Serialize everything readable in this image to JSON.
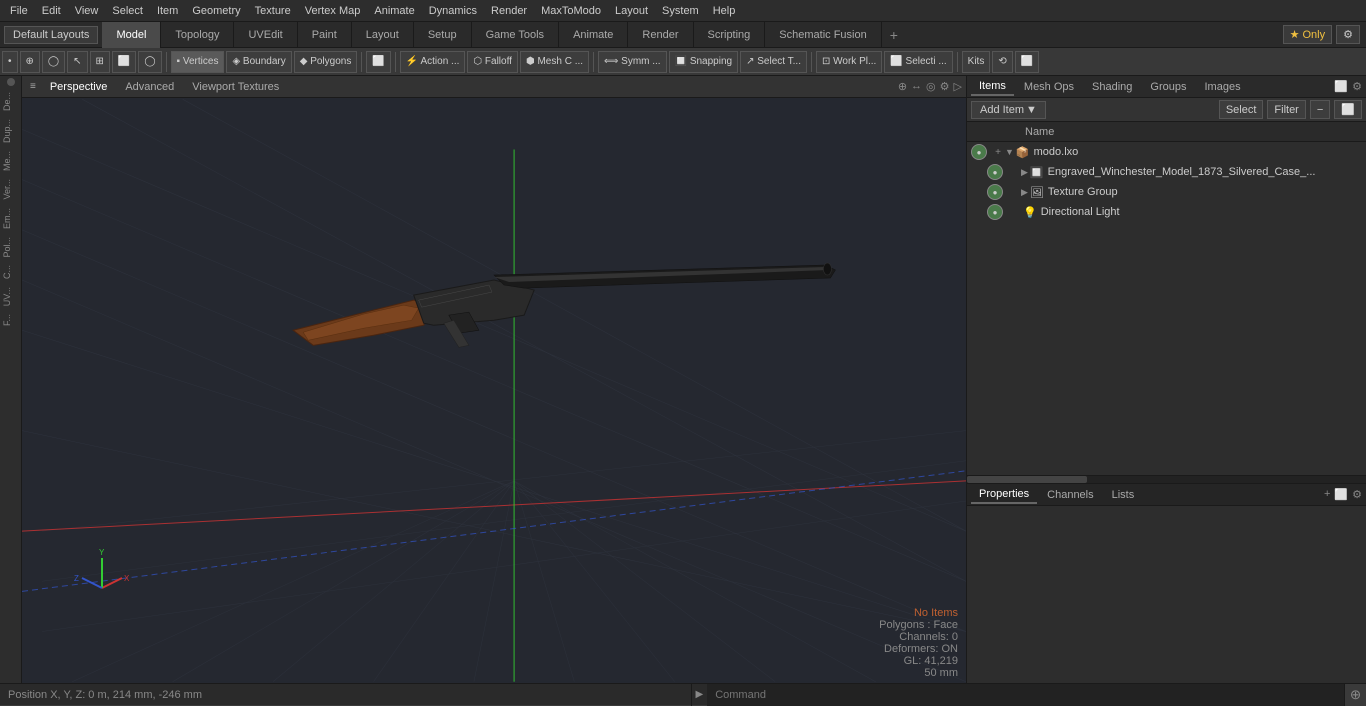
{
  "menubar": {
    "items": [
      "File",
      "Edit",
      "View",
      "Select",
      "Item",
      "Geometry",
      "Texture",
      "Vertex Map",
      "Animate",
      "Dynamics",
      "Render",
      "MaxToModo",
      "Layout",
      "System",
      "Help"
    ]
  },
  "layoutbar": {
    "layout_label": "Default Layouts",
    "tabs": [
      "Model",
      "Topology",
      "UVEdit",
      "Paint",
      "Layout",
      "Setup",
      "Game Tools",
      "Animate",
      "Render",
      "Scripting",
      "Schematic Fusion"
    ],
    "active_tab": "Model",
    "add_btn": "+",
    "star_label": "★ Only",
    "settings_label": "⚙"
  },
  "toolsbar": {
    "left_tools": [
      "•",
      "⊕",
      "◯",
      "↖",
      "⊞",
      "⬜",
      "◯"
    ],
    "selection_modes": [
      "Vertices",
      "Boundary",
      "Polygons"
    ],
    "tools": [
      "Action ...",
      "Falloff",
      "Mesh C ...",
      "Symm ...",
      "Snapping",
      "Select T...",
      "Work Pl...",
      "Selecti ...",
      "Kits"
    ],
    "right_icons": [
      "⟲",
      "⬜"
    ]
  },
  "viewport": {
    "tabs": [
      "Perspective",
      "Advanced",
      "Viewport Textures"
    ],
    "active_tab": "Perspective",
    "icons": [
      "⊕",
      "↔",
      "◯",
      "⚙",
      "▷"
    ],
    "status": {
      "no_items": "No Items",
      "polygons": "Polygons : Face",
      "channels": "Channels: 0",
      "deformers": "Deformers: ON",
      "gl": "GL: 41,219",
      "size": "50 mm"
    }
  },
  "items_panel": {
    "tabs": [
      "Items",
      "Mesh Ops",
      "Shading",
      "Groups",
      "Images"
    ],
    "active_tab": "Items",
    "add_item_label": "Add Item",
    "toolbar_right": [
      "Select",
      "Filter"
    ],
    "col_header": "Name",
    "tree": [
      {
        "id": "root",
        "indent": 0,
        "icon": "📦",
        "name": "modo.lxo",
        "eye": true,
        "plus": true,
        "arrow": "▼",
        "has_children": true
      },
      {
        "id": "mesh",
        "indent": 1,
        "icon": "🔲",
        "name": "Engraved_Winchester_Model_1873_Silvered_Case_...",
        "eye": true,
        "plus": false,
        "arrow": "▶",
        "has_children": true
      },
      {
        "id": "texgrp",
        "indent": 1,
        "icon": "🖼",
        "name": "Texture Group",
        "eye": true,
        "plus": false,
        "arrow": "▶",
        "has_children": false
      },
      {
        "id": "light",
        "indent": 1,
        "icon": "💡",
        "name": "Directional Light",
        "eye": true,
        "plus": false,
        "arrow": "",
        "has_children": false
      }
    ]
  },
  "properties_panel": {
    "tabs": [
      "Properties",
      "Channels",
      "Lists"
    ],
    "active_tab": "Properties",
    "add_tab_label": "+"
  },
  "bottombar": {
    "position_label": "Position X, Y, Z:  0 m, 214 mm, -246 mm",
    "command_placeholder": "Command"
  },
  "sidebar_labels": [
    "De...",
    "Dup...",
    "Me...",
    "Ver...",
    "Em...",
    "Pol...",
    "C...",
    "UV...",
    "F..."
  ]
}
